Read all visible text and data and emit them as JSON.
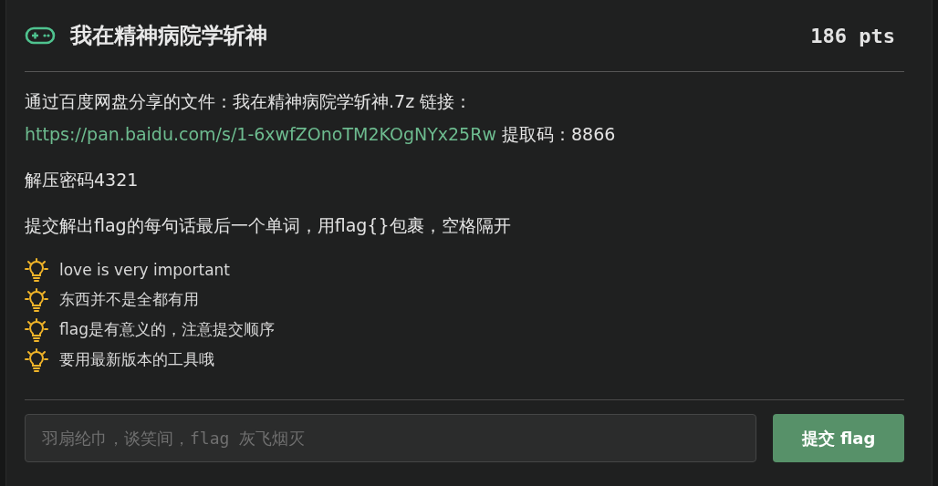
{
  "challenge": {
    "title": "我在精神病院学斩神",
    "points": "186 pts"
  },
  "description": {
    "before": "通过百度网盘分享的文件：我在精神病院学斩神.7z 链接：",
    "link": "https://pan.baidu.com/s/1-6xwfZOnoTM2KOgNYx25Rw",
    "after": " 提取码：8866"
  },
  "paragraphs": [
    "解压密码4321",
    "提交解出flag的每句话最后一个单词，用flag{}包裹，空格隔开"
  ],
  "hints": [
    "love is very important",
    "东西并不是全都有用",
    "flag是有意义的，注意提交顺序",
    "要用最新版本的工具哦"
  ],
  "flag_field": {
    "placeholder": "羽扇纶巾，谈笑间，flag 灰飞烟灭"
  },
  "submit_button": "提交 flag"
}
